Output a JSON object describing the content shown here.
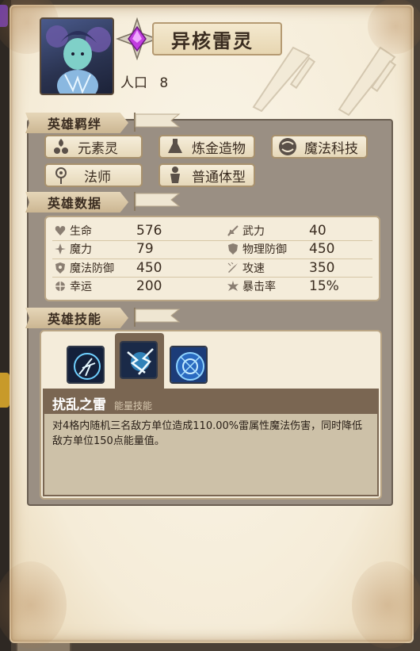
{
  "hero": {
    "name": "异核雷灵",
    "population_label": "人口",
    "population_value": "8"
  },
  "sections": {
    "bonds_title": "英雄羁绊",
    "stats_title": "英雄数据",
    "skills_title": "英雄技能"
  },
  "bonds": [
    {
      "label": "元素灵",
      "icon": "element-spirit-icon"
    },
    {
      "label": "炼金造物",
      "icon": "alchemy-flask-icon"
    },
    {
      "label": "魔法科技",
      "icon": "magitech-icon"
    },
    {
      "label": "法师",
      "icon": "mage-icon"
    },
    {
      "label": "普通体型",
      "icon": "normal-body-icon"
    }
  ],
  "stats": {
    "left": [
      {
        "label": "生命",
        "value": "576",
        "icon": "heart-icon"
      },
      {
        "label": "魔力",
        "value": "79",
        "icon": "sparkle-icon"
      },
      {
        "label": "魔法防御",
        "value": "450",
        "icon": "magic-shield-icon"
      },
      {
        "label": "幸运",
        "value": "200",
        "icon": "clover-icon"
      }
    ],
    "right": [
      {
        "label": "武力",
        "value": "40",
        "icon": "sword-icon"
      },
      {
        "label": "物理防御",
        "value": "450",
        "icon": "shield-icon"
      },
      {
        "label": "攻速",
        "value": "350",
        "icon": "speed-icon"
      },
      {
        "label": "暴击率",
        "value": "15%",
        "icon": "crit-icon"
      }
    ]
  },
  "skills": {
    "icons": [
      "lightning-orb-icon",
      "lightning-burst-icon",
      "blue-rune-icon"
    ],
    "selected_index": 1,
    "selected_name": "扰乱之雷",
    "selected_type": "能量技能",
    "description": "对4格内随机三名敌方单位造成110.00%雷属性魔法伤害，同时降低敌方单位150点能量值。"
  },
  "colors": {
    "parchment": "#f5ecd8",
    "frame": "#9a8f83",
    "skill_header": "#7a6652",
    "emblem_gem": "#c23ee0"
  }
}
